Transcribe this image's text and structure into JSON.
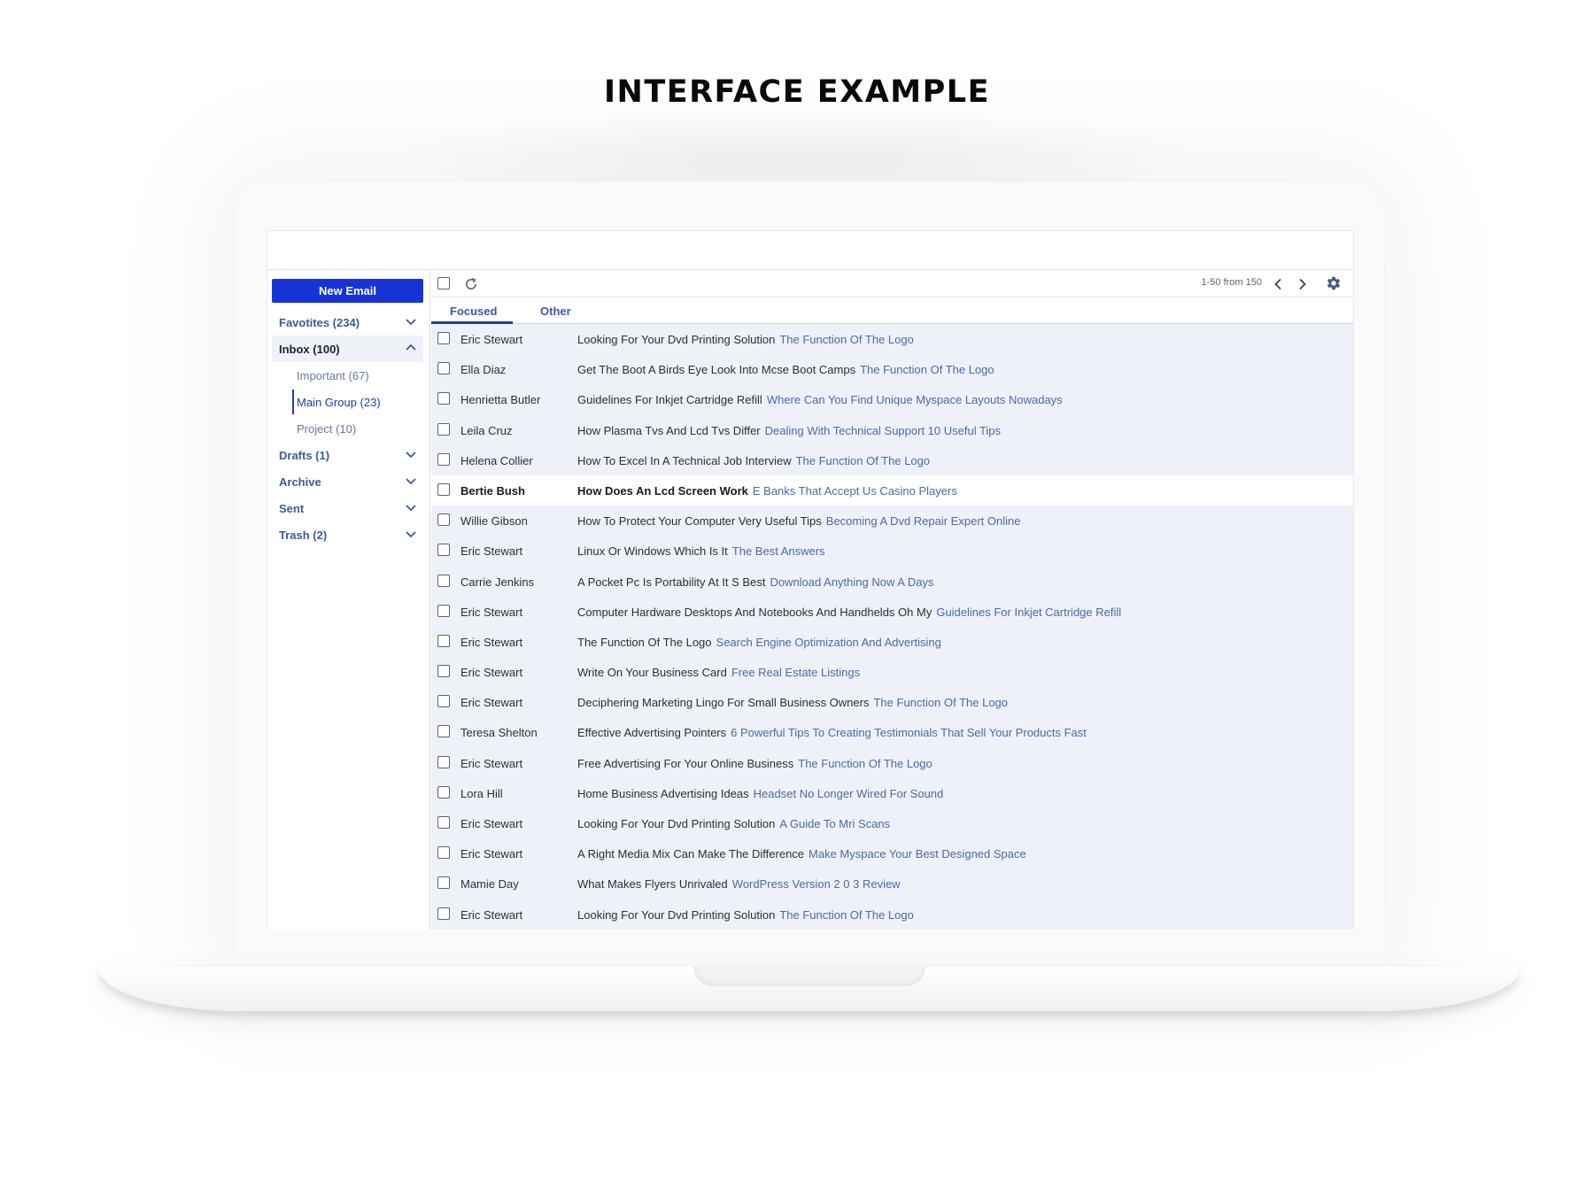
{
  "page": {
    "title": "INTERFACE EXAMPLE"
  },
  "colors": {
    "primary": "#1634d6",
    "link": "#4d69a8",
    "list_background": "#eef1f7",
    "text": "#2b2f3a"
  },
  "sidebar": {
    "new_email_label": "New Email",
    "folders": [
      {
        "label": "Favotites (234)",
        "icon": "chevron-down-icon",
        "expanded": false
      },
      {
        "label": "Inbox (100)",
        "icon": "chevron-up-icon",
        "expanded": true,
        "active": true
      },
      {
        "label": "Drafts (1)",
        "icon": "chevron-down-icon",
        "expanded": false
      },
      {
        "label": "Archive",
        "icon": "chevron-down-icon",
        "expanded": false
      },
      {
        "label": "Sent",
        "icon": "chevron-down-icon",
        "expanded": false
      },
      {
        "label": "Trash (2)",
        "icon": "chevron-down-icon",
        "expanded": false
      }
    ],
    "inbox_subfolders": [
      {
        "label": "Important (67)"
      },
      {
        "label": "Main Group (23)",
        "selected": true
      },
      {
        "label": "Project (10)"
      }
    ]
  },
  "toolbar": {
    "pagination": "1-50 from 150",
    "icons": [
      "select-all-checkbox",
      "refresh-icon",
      "chevron-left-icon",
      "chevron-right-icon",
      "gear-icon"
    ]
  },
  "tabs": [
    {
      "label": "Focused",
      "active": true
    },
    {
      "label": "Other",
      "active": false
    }
  ],
  "emails": [
    {
      "sender": "Eric Stewart",
      "subject": "Looking For Your Dvd Printing Solution",
      "preview": "The Function Of The Logo",
      "unread": false
    },
    {
      "sender": "Ella Diaz",
      "subject": "Get The Boot A Birds Eye Look Into Mcse Boot Camps",
      "preview": "The Function Of The Logo",
      "unread": false
    },
    {
      "sender": "Henrietta Butler",
      "subject": "Guidelines For Inkjet Cartridge Refill",
      "preview": "Where Can You Find Unique Myspace Layouts Nowadays",
      "unread": false
    },
    {
      "sender": "Leila Cruz",
      "subject": "How Plasma Tvs And Lcd Tvs Differ",
      "preview": "Dealing With Technical Support 10 Useful Tips",
      "unread": false
    },
    {
      "sender": "Helena Collier",
      "subject": "How To Excel In A Technical Job Interview",
      "preview": "The Function Of The Logo",
      "unread": false
    },
    {
      "sender": "Bertie Bush",
      "subject": "How Does An Lcd Screen Work",
      "preview": "E Banks That Accept Us Casino Players",
      "unread": true
    },
    {
      "sender": "Willie Gibson",
      "subject": "How To Protect Your Computer Very Useful Tips",
      "preview": "Becoming A Dvd Repair Expert Online",
      "unread": false
    },
    {
      "sender": "Eric Stewart",
      "subject": "Linux Or Windows Which Is It",
      "preview": "The Best Answers",
      "unread": false
    },
    {
      "sender": "Carrie Jenkins",
      "subject": "A Pocket Pc Is Portability At It S Best",
      "preview": "Download Anything Now A Days",
      "unread": false
    },
    {
      "sender": "Eric Stewart",
      "subject": "Computer Hardware Desktops And Notebooks And Handhelds Oh My",
      "preview": "Guidelines For Inkjet Cartridge Refill",
      "unread": false
    },
    {
      "sender": "Eric Stewart",
      "subject": "The Function Of The Logo",
      "preview": "Search Engine Optimization And Advertising",
      "unread": false
    },
    {
      "sender": "Eric Stewart",
      "subject": "Write On Your Business Card",
      "preview": "Free Real Estate Listings",
      "unread": false
    },
    {
      "sender": "Eric Stewart",
      "subject": "Deciphering Marketing Lingo For Small Business Owners",
      "preview": "The Function Of The Logo",
      "unread": false
    },
    {
      "sender": "Teresa Shelton",
      "subject": "Effective Advertising Pointers",
      "preview": "6 Powerful Tips To Creating Testimonials That Sell Your Products Fast",
      "unread": false
    },
    {
      "sender": "Eric Stewart",
      "subject": "Free Advertising For Your Online Business",
      "preview": "The Function Of The Logo",
      "unread": false
    },
    {
      "sender": "Lora Hill",
      "subject": "Home Business Advertising Ideas",
      "preview": "Headset No Longer Wired For Sound",
      "unread": false
    },
    {
      "sender": "Eric Stewart",
      "subject": "Looking For Your Dvd Printing Solution",
      "preview": "A Guide To Mri Scans",
      "unread": false
    },
    {
      "sender": "Eric Stewart",
      "subject": "A Right Media Mix Can Make The Difference",
      "preview": "Make Myspace Your Best Designed Space",
      "unread": false
    },
    {
      "sender": "Mamie Day",
      "subject": "What Makes Flyers Unrivaled",
      "preview": "WordPress Version 2 0 3 Review",
      "unread": false
    },
    {
      "sender": "Eric Stewart",
      "subject": "Looking For Your Dvd Printing Solution",
      "preview": "The Function Of The Logo",
      "unread": false
    }
  ]
}
